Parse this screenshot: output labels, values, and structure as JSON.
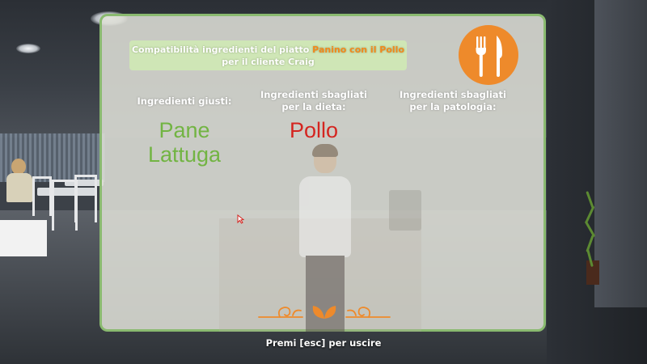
{
  "dialog": {
    "title_prefix": "Compatibilità ingredienti del piatto",
    "dish_name": "Panino con il Pollo",
    "title_suffix": "per il cliente Craig",
    "icon": "fork-knife-icon",
    "ornament_icon": "leaf-flourish-icon"
  },
  "columns": {
    "correct": {
      "header": "Ingredienti giusti:",
      "items": [
        "Pane",
        "Lattuga"
      ],
      "color": "#72b443"
    },
    "wrong_diet": {
      "header": "Ingredienti sbagliati per la dieta:",
      "items": [
        "Pollo"
      ],
      "color": "#d42520"
    },
    "wrong_pathology": {
      "header": "Ingredienti sbagliati per la patologia:",
      "items": []
    }
  },
  "footer": {
    "exit_hint": "Premi [esc] per uscire"
  },
  "colors": {
    "panel_border": "#8aba70",
    "title_bg": "#cfe6b6",
    "accent_orange": "#ee8a2b"
  }
}
